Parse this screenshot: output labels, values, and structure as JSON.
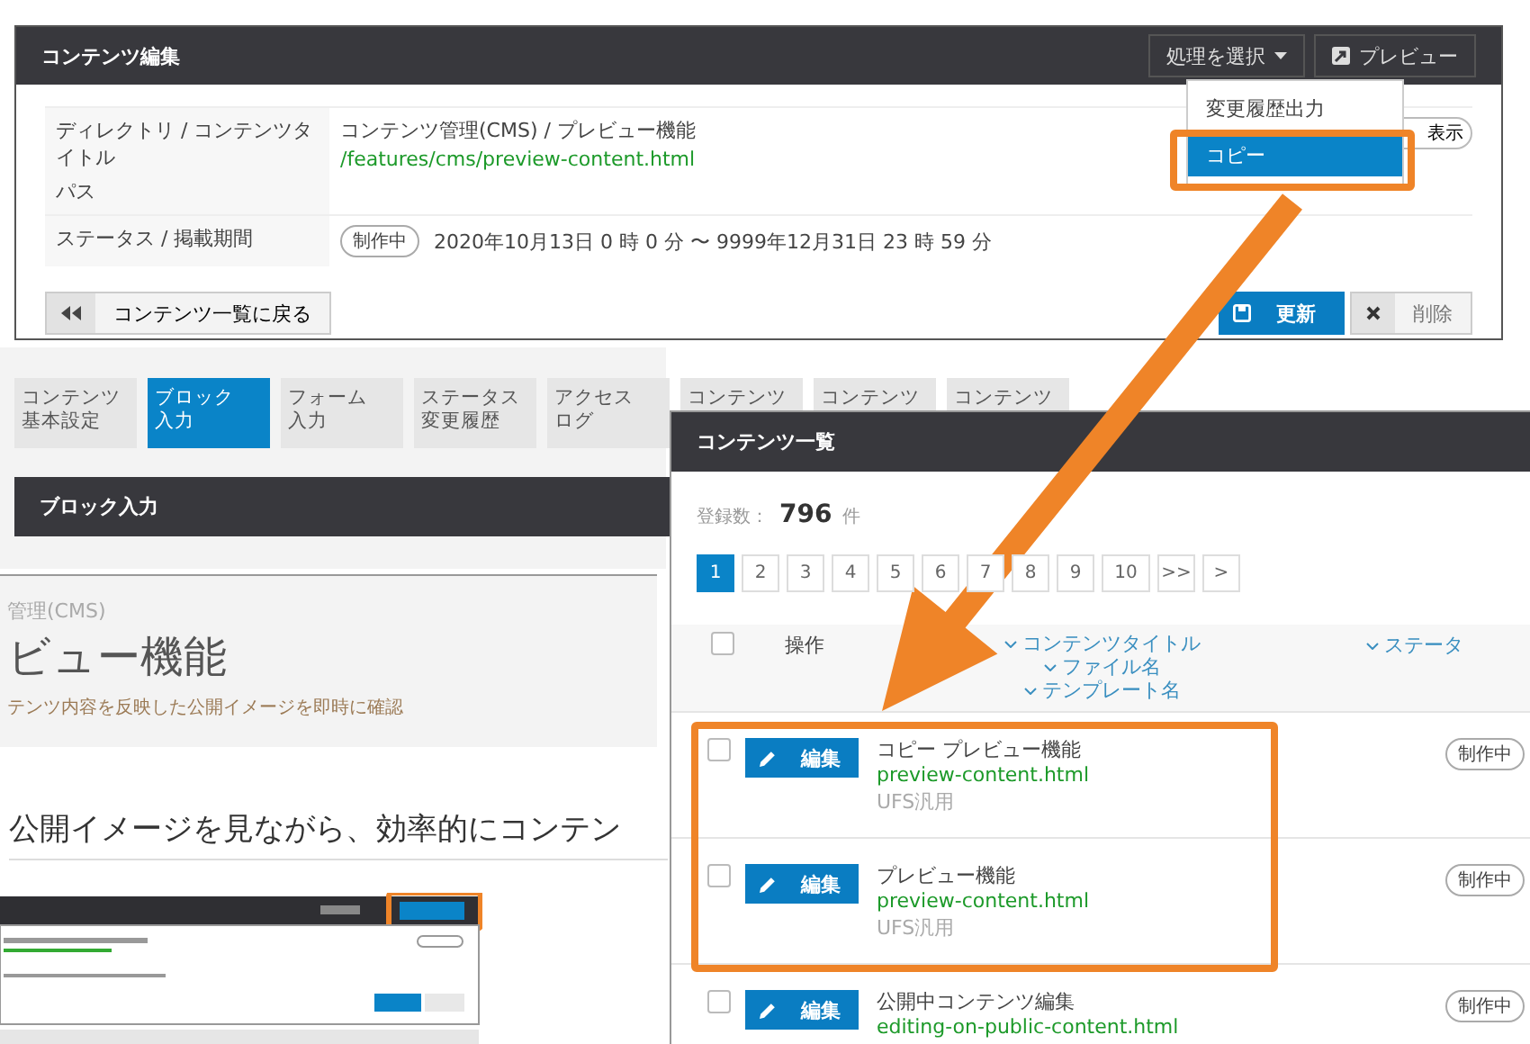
{
  "editor": {
    "title": "コンテンツ編集",
    "action_select": "処理を選択",
    "preview_button": "プレビュー",
    "rows": [
      {
        "labels": [
          "ディレクトリ / コンテンツタイトル",
          "パス"
        ],
        "values": [
          {
            "text": "コンテンツ管理(CMS) / プレビュー機能",
            "kind": "plain"
          },
          {
            "text": "/features/cms/preview-content.html",
            "kind": "path"
          }
        ],
        "side_button": "表示"
      },
      {
        "labels": [
          "ステータス / 掲載期間"
        ],
        "badge": "制作中",
        "values": [
          {
            "text": "2020年10月13日 0 時  0 分 〜 9999年12月31日 23 時  59 分",
            "kind": "plain"
          }
        ]
      }
    ],
    "back_button": "コンテンツ一覧に戻る",
    "update_button": "更新",
    "delete_button": "削除"
  },
  "action_menu": [
    {
      "label": "変更履歴出力",
      "selected": false
    },
    {
      "label": "コピー",
      "selected": true
    }
  ],
  "tabs": [
    {
      "lines": [
        "コンテンツ",
        "基本設定"
      ],
      "selected": false
    },
    {
      "lines": [
        "ブロック",
        "入力"
      ],
      "selected": true
    },
    {
      "lines": [
        "フォーム",
        "入力"
      ],
      "selected": false
    },
    {
      "lines": [
        "ステータス",
        "変更履歴"
      ],
      "selected": false
    },
    {
      "lines": [
        "アクセス",
        "ログ"
      ],
      "selected": false
    },
    {
      "lines": [
        "コンテンツ"
      ],
      "selected": false
    },
    {
      "lines": [
        "コンテンツ"
      ],
      "selected": false
    },
    {
      "lines": [
        "コンテンツ"
      ],
      "selected": false
    }
  ],
  "block_panel": {
    "title": "ブロック入力"
  },
  "preview": {
    "category": "管理(CMS)",
    "title": "ビュー機能",
    "lead": "テンツ内容を反映した公開イメージを即時に確認",
    "heading": "公開イメージを見ながら、効率的にコンテン"
  },
  "list": {
    "title": "コンテンツ一覧",
    "count_label": "登録数：",
    "count": "796",
    "count_unit": "件",
    "pages": [
      {
        "label": "1",
        "selected": true
      },
      {
        "label": "2",
        "selected": false
      },
      {
        "label": "3",
        "selected": false
      },
      {
        "label": "4",
        "selected": false
      },
      {
        "label": "5",
        "selected": false
      },
      {
        "label": "6",
        "selected": false
      },
      {
        "label": "7",
        "selected": false
      },
      {
        "label": "8",
        "selected": false
      },
      {
        "label": "9",
        "selected": false
      },
      {
        "label": "10",
        "selected": false
      },
      {
        "label": ">>",
        "selected": false
      },
      {
        "label": ">",
        "selected": false
      }
    ],
    "select_all_checked": false,
    "action_column": "操作",
    "sort_links": [
      "コンテンツタイトル",
      "ファイル名",
      "テンプレート名"
    ],
    "status_column": "ステータ",
    "rows": [
      {
        "checked": false,
        "edit": "編集",
        "title": "コピー プレビュー機能",
        "file": "preview-content.html",
        "template": "UFS汎用",
        "status": "制作中"
      },
      {
        "checked": false,
        "edit": "編集",
        "title": "プレビュー機能",
        "file": "preview-content.html",
        "template": "UFS汎用",
        "status": "制作中"
      },
      {
        "checked": false,
        "edit": "編集",
        "title": "公開中コンテンツ編集",
        "file": "editing-on-public-content.html",
        "status": "制作中"
      }
    ]
  }
}
